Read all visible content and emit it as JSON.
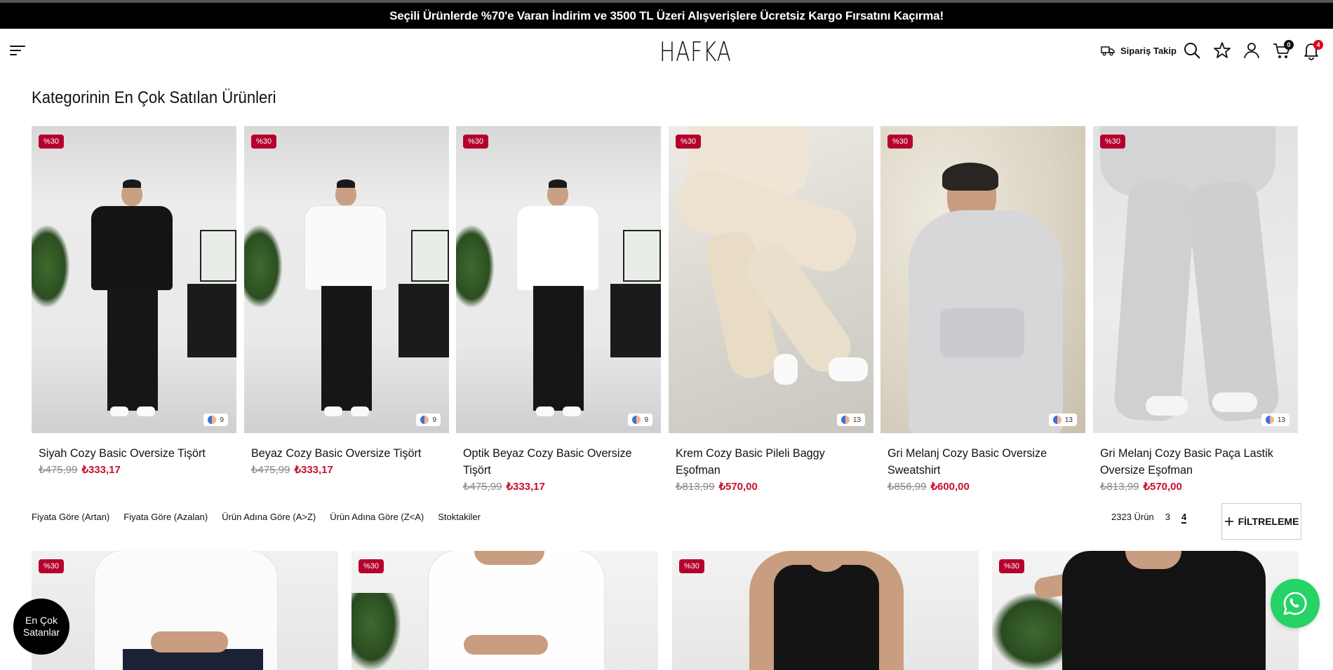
{
  "announcement": "Seçili Ürünlerde %70'e Varan İndirim ve 3500 TL Üzeri Alışverişlere Ücretsiz Kargo Fırsatını Kaçırma!",
  "header": {
    "logo": "HAFKA",
    "order_track_label": "Sipariş Takip",
    "cart_count": "0",
    "notification_count": "4",
    "icons": [
      "menu-icon",
      "truck-icon",
      "search-icon",
      "star-icon",
      "user-icon",
      "cart-icon",
      "bell-icon"
    ]
  },
  "section_title": "Kategorinin En Çok Satılan Ürünleri",
  "bestsellers": [
    {
      "name": "Siyah Cozy Basic Oversize Tişört",
      "old_price": "₺475,99",
      "new_price": "₺333,17",
      "discount": "%30",
      "color_count": "9"
    },
    {
      "name": "Beyaz Cozy Basic Oversize Tişört",
      "old_price": "₺475,99",
      "new_price": "₺333,17",
      "discount": "%30",
      "color_count": "9"
    },
    {
      "name": "Optik Beyaz Cozy Basic Oversize Tişört",
      "old_price": "₺475,99",
      "new_price": "₺333,17",
      "discount": "%30",
      "color_count": "9"
    },
    {
      "name": "Krem Cozy Basic Pileli Baggy Eşofman",
      "old_price": "₺813,99",
      "new_price": "₺570,00",
      "discount": "%30",
      "color_count": "13"
    },
    {
      "name": "Gri Melanj Cozy Basic Oversize Sweatshirt",
      "old_price": "₺856,99",
      "new_price": "₺600,00",
      "discount": "%30",
      "color_count": "13"
    },
    {
      "name": "Gri Melanj Cozy Basic Paça Lastik Oversize Eşofman",
      "old_price": "₺813,99",
      "new_price": "₺570,00",
      "discount": "%30",
      "color_count": "13"
    }
  ],
  "sort_options": [
    "Fiyata Göre (Artan)",
    "Fiyata Göre (Azalan)",
    "Ürün Adına Göre (A>Z)",
    "Ürün Adına Göre (Z<A)",
    "Stoktakiler"
  ],
  "product_count": "2323 Ürün",
  "grid_options": [
    "3",
    "4"
  ],
  "filter_label": "FİLTRELEME",
  "grid_products": [
    {
      "discount": "%30"
    },
    {
      "discount": "%30"
    },
    {
      "discount": "%30"
    },
    {
      "discount": "%30"
    }
  ],
  "bestseller_button": "En Çok Satanlar",
  "colors": {
    "discount": "#b5002e",
    "sale_price": "#c8102e",
    "whatsapp": "#25d366",
    "badge": "#e0001b"
  }
}
